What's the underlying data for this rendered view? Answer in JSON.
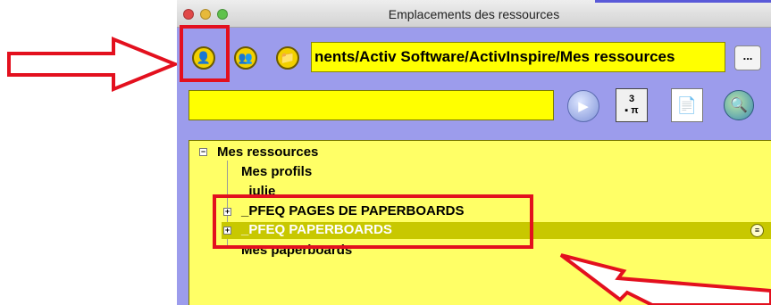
{
  "window": {
    "title": "Emplacements des ressources"
  },
  "toolbar": {
    "icons": [
      {
        "name": "user-icon",
        "glyph": "👤"
      },
      {
        "name": "users-icon",
        "glyph": "👥"
      },
      {
        "name": "folder-icon",
        "glyph": "📁"
      }
    ],
    "path_value": "nents/Activ Software/ActivInspire/Mes ressources",
    "more_label": "..."
  },
  "search": {
    "value": ""
  },
  "tools": {
    "calc_top": "3",
    "calc_bottom": "▪ π",
    "doc_glyph": "📄",
    "globe_glyph": "🔍",
    "go_glyph": "▶"
  },
  "tree": {
    "root": "Mes ressources",
    "items": [
      {
        "label": "Mes profils"
      },
      {
        "label": "_julie"
      },
      {
        "label": "_PFEQ PAGES DE PAPERBOARDS"
      },
      {
        "label": "_PFEQ PAPERBOARDS",
        "selected": true
      },
      {
        "label": "Mes paperboards"
      }
    ],
    "expander_minus": "−",
    "expander_plus": "+",
    "selected_icon": "≡"
  },
  "colors": {
    "window_bg": "#9c9cec",
    "field_yellow": "#ffff00",
    "tree_bg": "#ffff66",
    "selection": "#c8c800",
    "annotation_red": "#e3101e"
  }
}
